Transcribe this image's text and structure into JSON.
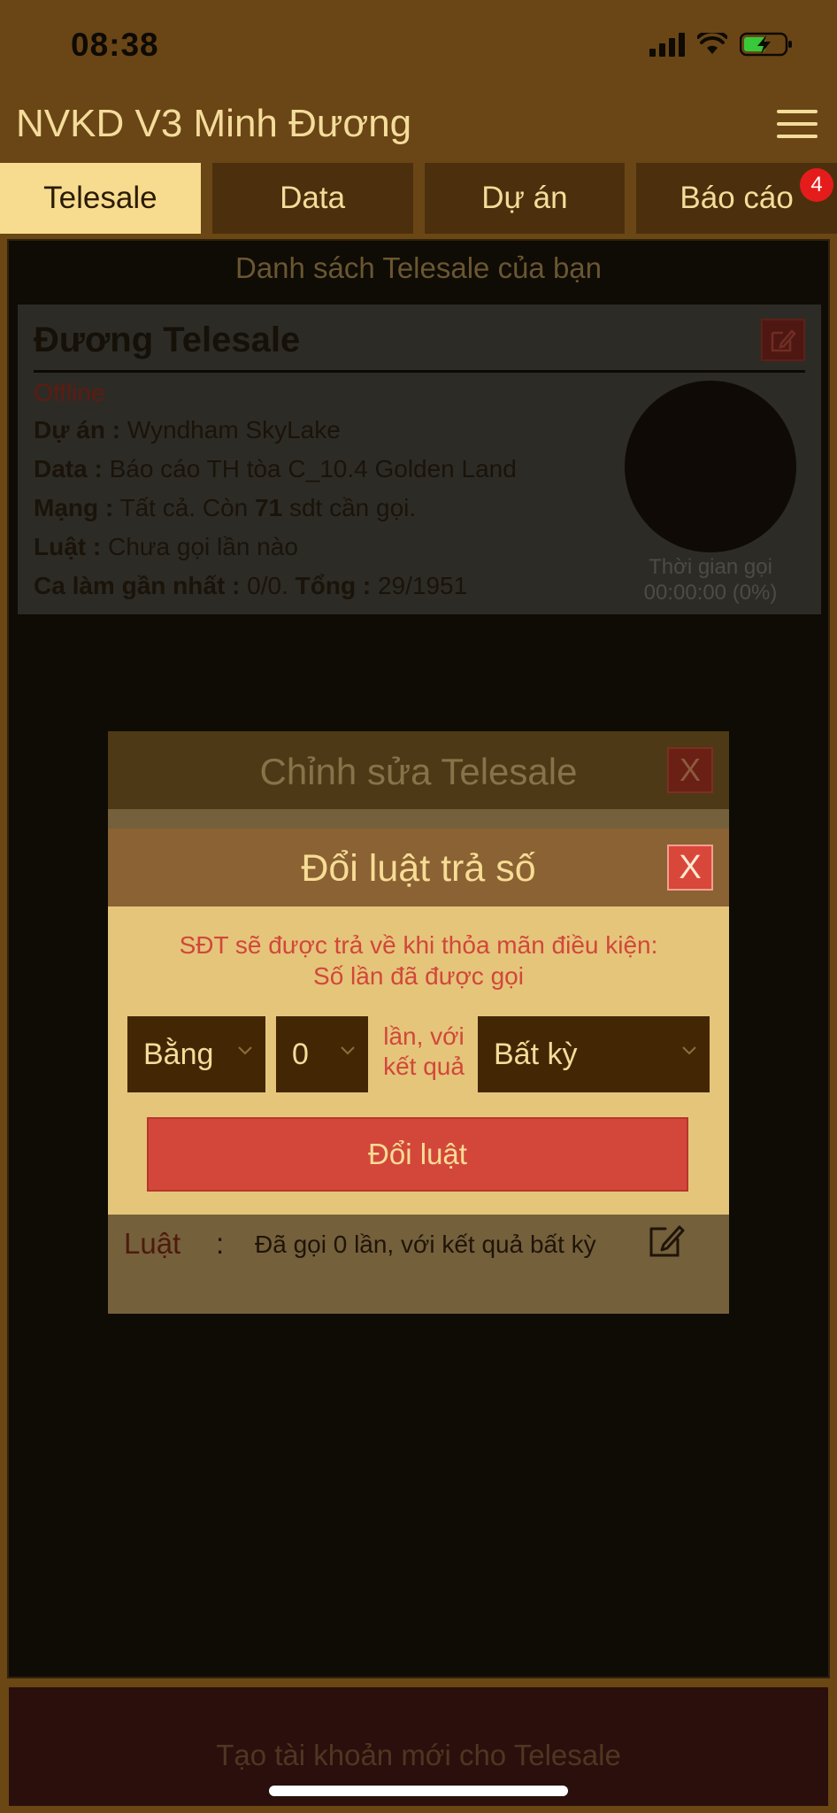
{
  "status_bar": {
    "time": "08:38"
  },
  "header": {
    "title": "NVKD V3 Minh Đương"
  },
  "tabs": [
    {
      "label": "Telesale",
      "active": true
    },
    {
      "label": "Data"
    },
    {
      "label": "Dự án"
    },
    {
      "label": "Báo cáo",
      "badge": "4"
    }
  ],
  "list": {
    "title": "Danh sách Telesale của bạn",
    "card": {
      "name": "Đương Telesale",
      "status": "Offline",
      "project_label": "Dự án :",
      "project_value": " Wyndham SkyLake",
      "data_label": "Data :",
      "data_value": " Báo cáo TH tòa C_10.4 Golden Land",
      "network_label": "Mạng :",
      "network_value": " Tất cả. Còn ",
      "network_count": "71",
      "network_suffix": " sdt cần gọi.",
      "rule_label": "Luật :",
      "rule_value": " Chưa gọi lần nào",
      "shift_label": "Ca làm gần nhất :",
      "shift_value": " 0/0. ",
      "total_label": "Tổng :",
      "total_value": " 29/1951",
      "call_time_label": "Thời gian gọi",
      "call_time_value": "00:00:00 (0%)"
    }
  },
  "bottom_button": "Tạo tài khoản mới cho Telesale",
  "edit_modal": {
    "title": "Chỉnh sửa Telesale",
    "close": "X",
    "rule_label": "Luật",
    "rule_colon": ":",
    "rule_value": "Đã gọi 0 lần, với kết quả bất kỳ"
  },
  "rule_modal": {
    "title": "Đổi luật trả số",
    "close": "X",
    "message_line1": "SĐT sẽ được trả về khi thỏa mãn điều kiện:",
    "message_line2": "Số lần đã được gọi",
    "comparator": "Bằng",
    "count": "0",
    "mid_line1": "lần, với",
    "mid_line2": "kết quả",
    "result": "Bất kỳ",
    "apply": "Đổi luật"
  }
}
